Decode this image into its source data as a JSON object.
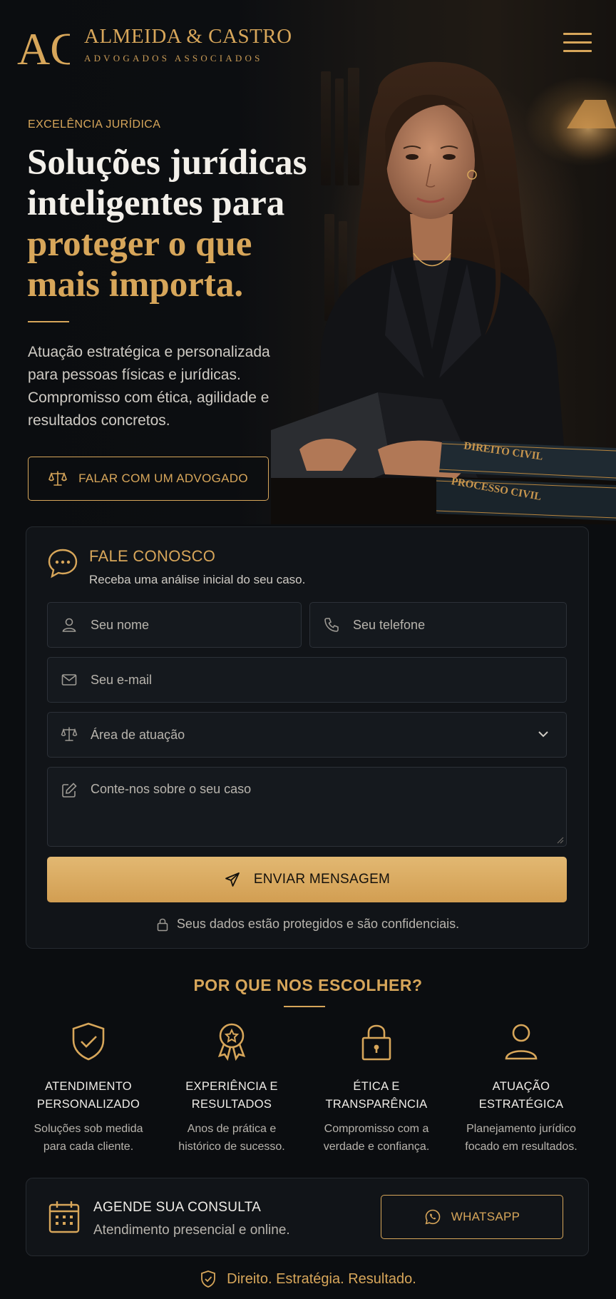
{
  "brand": {
    "monogram": "AC",
    "name": "ALMEIDA & CASTRO",
    "subtitle": "ADVOGADOS ASSOCIADOS",
    "accent_color": "#d7a65a"
  },
  "nav": {
    "menu_icon": "hamburger-menu-icon"
  },
  "hero": {
    "eyebrow": "EXCELÊNCIA JURÍDICA",
    "headline_white_1": "Soluções jurídicas",
    "headline_white_2": "inteligentes para",
    "headline_gold_1": "proteger o que",
    "headline_gold_2": "mais importa.",
    "lead": "Atuação estratégica e personalizada para pessoas físicas e jurídicas. Compromisso com ética, agilidade e resultados concretos.",
    "cta_label": "FALAR COM UM ADVOGADO",
    "cta_icon": "scales-icon",
    "book_1": "DIREITO CIVIL",
    "book_2": "PROCESSO CIVIL"
  },
  "contact_form": {
    "title": "FALE CONOSCO",
    "subtitle": "Receba uma análise inicial do seu caso.",
    "name_placeholder": "Seu nome",
    "phone_placeholder": "Seu telefone",
    "email_placeholder": "Seu e-mail",
    "area_placeholder": "Área de atuação",
    "message_placeholder": "Conte-nos sobre o seu caso",
    "submit_label": "ENVIAR MENSAGEM",
    "privacy_note": "Seus dados estão protegidos e são confidenciais."
  },
  "why": {
    "title": "POR QUE NOS ESCOLHER?",
    "features": [
      {
        "icon": "shield-check-icon",
        "title_1": "ATENDIMENTO",
        "title_2": "PERSONALIZADO",
        "desc_1": "Soluções sob medida",
        "desc_2": "para cada cliente."
      },
      {
        "icon": "award-ribbon-icon",
        "title_1": "EXPERIÊNCIA E",
        "title_2": "RESULTADOS",
        "desc_1": "Anos de prática e",
        "desc_2": "histórico de sucesso."
      },
      {
        "icon": "padlock-icon",
        "title_1": "ÉTICA E",
        "title_2": "TRANSPARÊNCIA",
        "desc_1": "Compromisso com a",
        "desc_2": "verdade e confiança."
      },
      {
        "icon": "user-icon",
        "title_1": "ATUAÇÃO",
        "title_2": "ESTRATÉGICA",
        "desc_1": "Planejamento jurídico",
        "desc_2": "focado em resultados."
      }
    ]
  },
  "schedule": {
    "title": "AGENDE SUA CONSULTA",
    "subtitle": "Atendimento presencial e online.",
    "whatsapp_label": "WHATSAPP"
  },
  "footer": {
    "tagline": "Direito. Estratégia. Resultado."
  }
}
